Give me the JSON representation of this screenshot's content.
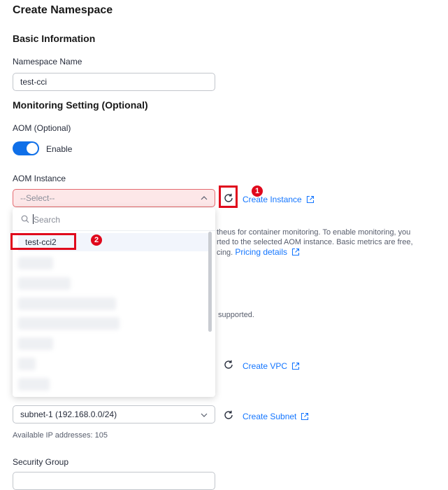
{
  "page": {
    "title": "Create Namespace"
  },
  "basic": {
    "heading": "Basic Information",
    "namespace_label": "Namespace Name",
    "namespace_value": "test-cci"
  },
  "monitoring": {
    "heading": "Monitoring Setting (Optional)",
    "aom_label": "AOM (Optional)",
    "toggle_label": "Enable",
    "toggle_on": true,
    "instance_label": "AOM Instance",
    "select_placeholder": "--Select--",
    "create_instance": "Create Instance",
    "info_line1": "theus for container monitoring. To enable monitoring, you",
    "info_line2": "rted to the selected AOM instance. Basic metrics are free,",
    "info_line3": "cing.",
    "pricing_link": "Pricing details",
    "supported_text": "supported."
  },
  "dropdown": {
    "search_placeholder": "Search",
    "options": [
      "test-cci2"
    ]
  },
  "network": {
    "create_vpc": "Create VPC",
    "subnet_value": "subnet-1 (192.168.0.0/24)",
    "create_subnet": "Create Subnet",
    "available_ip": "Available IP addresses: 105",
    "security_group_label": "Security Group"
  },
  "annotations": {
    "badge1": "1",
    "badge2": "2"
  },
  "colors": {
    "accent": "#0f6fe8",
    "link": "#1476ff",
    "annotation": "#e0081c",
    "error_bg": "#fde7e8"
  }
}
